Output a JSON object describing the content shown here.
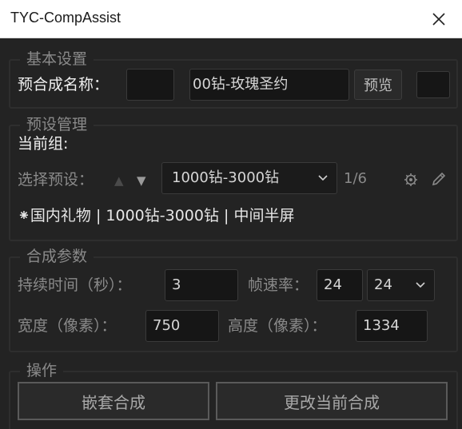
{
  "window": {
    "title": "TYC-CompAssist"
  },
  "basic": {
    "legend": "基本设置",
    "name_label": "预合成名称：",
    "name_prefix_value": "",
    "name_value": "00钻-玫瑰圣约",
    "preview_label": "预览"
  },
  "presets": {
    "legend": "预设管理",
    "current_group_label": "当前组:",
    "select_label": "选择预设：",
    "up_icon": "▲",
    "down_icon": "▼",
    "selected": "1000钻-3000钻",
    "count": "1/6",
    "info": "⁕国内礼物 | 1000钻-3000钻 | 中间半屏"
  },
  "params": {
    "legend": "合成参数",
    "duration_label": "持续时间（秒）：",
    "duration_value": "3",
    "fps_label": "帧速率：",
    "fps_value": "24",
    "fps_select": "24",
    "width_label": "宽度（像素）：",
    "width_value": "750",
    "height_label": "高度（像素）：",
    "height_value": "1334"
  },
  "actions": {
    "legend": "操作",
    "nest_label": "嵌套合成",
    "change_label": "更改当前合成"
  },
  "colors": {
    "background": "#232323",
    "titlebar": "#ffffff",
    "text": "#8a8a8a"
  }
}
